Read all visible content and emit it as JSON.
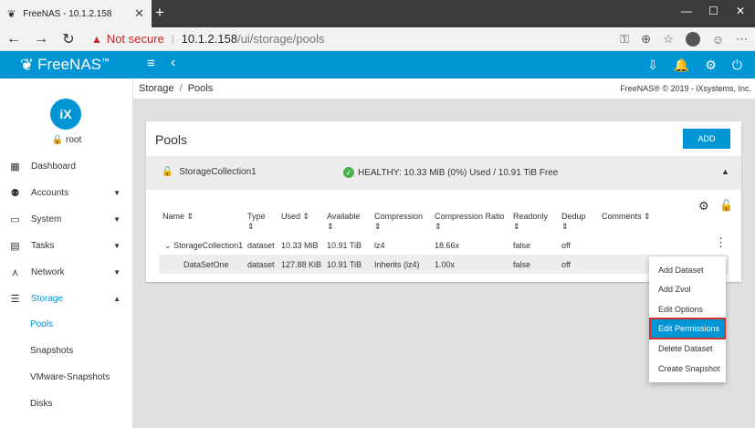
{
  "browser": {
    "tab_title": "FreeNAS - 10.1.2.158",
    "new_tab": "+",
    "not_secure": "Not secure",
    "url_host": "10.1.2.158",
    "url_path": "/ui/storage/pools",
    "window_controls": [
      "—",
      "☐",
      "✕"
    ]
  },
  "app": {
    "brand": "FreeNAS",
    "brand_tm": "™"
  },
  "sidebar": {
    "username": "root",
    "items": [
      {
        "label": "Dashboard",
        "icon": "dashboard-icon",
        "glyph": "▦"
      },
      {
        "label": "Accounts",
        "icon": "accounts-icon",
        "glyph": "👥",
        "caret": "▼"
      },
      {
        "label": "System",
        "icon": "system-icon",
        "glyph": "▭",
        "caret": "▼"
      },
      {
        "label": "Tasks",
        "icon": "tasks-icon",
        "glyph": "▤",
        "caret": "▼"
      },
      {
        "label": "Network",
        "icon": "network-icon",
        "glyph": "⋏",
        "caret": "▼"
      },
      {
        "label": "Storage",
        "icon": "storage-icon",
        "glyph": "☰",
        "caret": "▲"
      }
    ],
    "subitems": [
      "Pools",
      "Snapshots",
      "VMware-Snapshots",
      "Disks"
    ]
  },
  "breadcrumb": {
    "root": "Storage",
    "sep": "/",
    "current": "Pools"
  },
  "copyright": "FreeNAS® © 2019 - iXsystems, Inc.",
  "pools": {
    "title": "Pools",
    "add_label": "ADD",
    "pool_name": "StorageCollection1",
    "health": "HEALTHY: 10.33 MiB (0%) Used / 10.91 TiB Free",
    "columns": [
      "Name",
      "Type",
      "Used",
      "Available",
      "Compression",
      "Compression Ratio",
      "Readonly",
      "Dedup",
      "Comments"
    ],
    "rows": [
      {
        "name": "StorageCollection1",
        "type": "dataset",
        "used": "10.33 MiB",
        "available": "10.91 TiB",
        "compression": "lz4",
        "ratio": "18.66x",
        "readonly": "false",
        "dedup": "off"
      },
      {
        "name": "DataSetOne",
        "type": "dataset",
        "used": "127.88 KiB",
        "available": "10.91 TiB",
        "compression": "Inherits (lz4)",
        "ratio": "1.00x",
        "readonly": "false",
        "dedup": "off"
      }
    ]
  },
  "menu": {
    "items": [
      "Add Dataset",
      "Add Zvol",
      "Edit Options",
      "Edit Permissions",
      "Delete Dataset",
      "Create Snapshot"
    ],
    "highlighted": "Edit Permissions"
  },
  "colors": {
    "accent": "#0095d5",
    "healthy": "#4caf50",
    "highlight_border": "#d32f2f"
  }
}
